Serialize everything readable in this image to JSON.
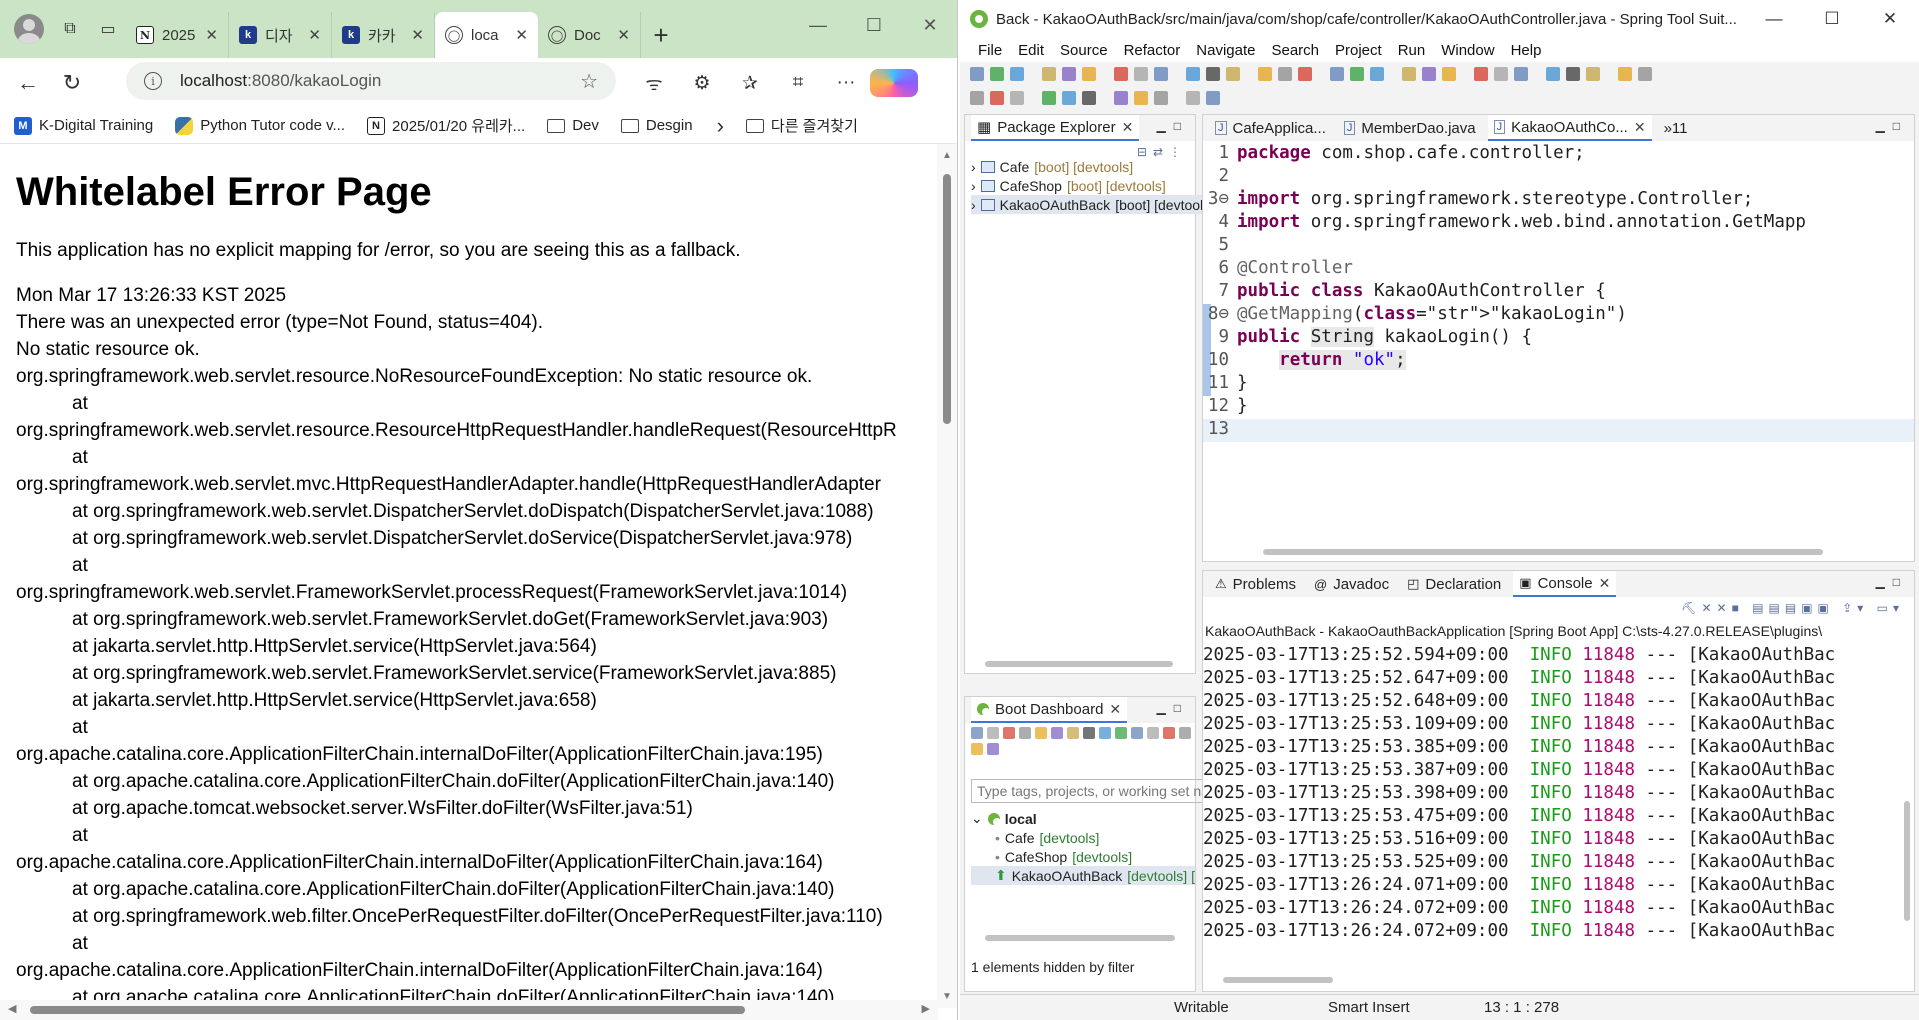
{
  "browser": {
    "tabs": [
      {
        "label": "2025",
        "icon": "notion-icon"
      },
      {
        "label": "디자",
        "icon": "k-icon"
      },
      {
        "label": "카카",
        "icon": "k-icon"
      },
      {
        "label": "loca",
        "icon": "globe-icon",
        "active": true
      },
      {
        "label": "Doc",
        "icon": "globe-icon"
      }
    ],
    "url_host": "localhost",
    "url_path": ":8080/kakaoLogin",
    "bookmarks": [
      {
        "label": "K-Digital Training",
        "icon": "m"
      },
      {
        "label": "Python Tutor code v...",
        "icon": "py"
      },
      {
        "label": "2025/01/20 유레카...",
        "icon": "n"
      },
      {
        "label": "Dev",
        "icon": "folder"
      },
      {
        "label": "Desgin",
        "icon": "folder"
      }
    ],
    "other_bookmarks": "다른 즐겨찾기"
  },
  "error_page": {
    "title": "Whitelabel Error Page",
    "message": "This application has no explicit mapping for /error, so you are seeing this as a fallback.",
    "timestamp": "Mon Mar 17 13:26:33 KST 2025",
    "error_line": "There was an unexpected error (type=Not Found, status=404).",
    "detail": "No static resource ok.",
    "trace": [
      {
        "text": "org.springframework.web.servlet.resource.NoResourceFoundException: No static resource ok.",
        "indent": false
      },
      {
        "text": "at",
        "indent": true
      },
      {
        "text": "org.springframework.web.servlet.resource.ResourceHttpRequestHandler.handleRequest(ResourceHttpR",
        "indent": false
      },
      {
        "text": "at",
        "indent": true
      },
      {
        "text": "org.springframework.web.servlet.mvc.HttpRequestHandlerAdapter.handle(HttpRequestHandlerAdapter",
        "indent": false
      },
      {
        "text": "at org.springframework.web.servlet.DispatcherServlet.doDispatch(DispatcherServlet.java:1088)",
        "indent": true
      },
      {
        "text": "at org.springframework.web.servlet.DispatcherServlet.doService(DispatcherServlet.java:978)",
        "indent": true
      },
      {
        "text": "at",
        "indent": true
      },
      {
        "text": "org.springframework.web.servlet.FrameworkServlet.processRequest(FrameworkServlet.java:1014)",
        "indent": false
      },
      {
        "text": "at org.springframework.web.servlet.FrameworkServlet.doGet(FrameworkServlet.java:903)",
        "indent": true
      },
      {
        "text": "at jakarta.servlet.http.HttpServlet.service(HttpServlet.java:564)",
        "indent": true
      },
      {
        "text": "at org.springframework.web.servlet.FrameworkServlet.service(FrameworkServlet.java:885)",
        "indent": true
      },
      {
        "text": "at jakarta.servlet.http.HttpServlet.service(HttpServlet.java:658)",
        "indent": true
      },
      {
        "text": "at",
        "indent": true
      },
      {
        "text": "org.apache.catalina.core.ApplicationFilterChain.internalDoFilter(ApplicationFilterChain.java:195)",
        "indent": false
      },
      {
        "text": "at org.apache.catalina.core.ApplicationFilterChain.doFilter(ApplicationFilterChain.java:140)",
        "indent": true
      },
      {
        "text": "at org.apache.tomcat.websocket.server.WsFilter.doFilter(WsFilter.java:51)",
        "indent": true
      },
      {
        "text": "at",
        "indent": true
      },
      {
        "text": "org.apache.catalina.core.ApplicationFilterChain.internalDoFilter(ApplicationFilterChain.java:164)",
        "indent": false
      },
      {
        "text": "at org.apache.catalina.core.ApplicationFilterChain.doFilter(ApplicationFilterChain.java:140)",
        "indent": true
      },
      {
        "text": "at org.springframework.web.filter.OncePerRequestFilter.doFilter(OncePerRequestFilter.java:110)",
        "indent": true
      },
      {
        "text": "at",
        "indent": true
      },
      {
        "text": "org.apache.catalina.core.ApplicationFilterChain.internalDoFilter(ApplicationFilterChain.java:164)",
        "indent": false
      },
      {
        "text": "at org.apache.catalina.core.ApplicationFilterChain.doFilter(ApplicationFilterChain.java:140)",
        "indent": true
      }
    ]
  },
  "sts": {
    "title": "Back - KakaoOAuthBack/src/main/java/com/shop/cafe/controller/KakaoOAuthController.java - Spring Tool Suit...",
    "menu": [
      "File",
      "Edit",
      "Source",
      "Refactor",
      "Navigate",
      "Search",
      "Project",
      "Run",
      "Window",
      "Help"
    ],
    "package_explorer": {
      "tab": "Package Explorer",
      "projects": [
        {
          "name": "Cafe",
          "tags": "[boot] [devtools]"
        },
        {
          "name": "CafeShop",
          "tags": "[boot] [devtools]"
        },
        {
          "name": "KakaoOAuthBack",
          "tags": "[boot] [devtools",
          "selected": true
        }
      ]
    },
    "editor_tabs": [
      "CafeApplica...",
      "MemberDao.java",
      "KakaoOAuthCo...",
      "»11"
    ],
    "code": [
      {
        "n": "1",
        "html": "package com.shop.cafe.controller;"
      },
      {
        "n": "2",
        "html": ""
      },
      {
        "n": "3⊖",
        "html": "import org.springframework.stereotype.Controller;"
      },
      {
        "n": "4",
        "html": "import org.springframework.web.bind.annotation.GetMapp"
      },
      {
        "n": "5",
        "html": ""
      },
      {
        "n": "6",
        "html": "@Controller"
      },
      {
        "n": "7",
        "html": "public class KakaoOAuthController {"
      },
      {
        "n": "8⊖",
        "html": "@GetMapping(\"kakaoLogin\")"
      },
      {
        "n": "9",
        "html": "public String kakaoLogin() {"
      },
      {
        "n": "10",
        "html": "    return \"ok\";"
      },
      {
        "n": "11",
        "html": "}"
      },
      {
        "n": "12",
        "html": "}"
      },
      {
        "n": "13",
        "html": ""
      }
    ],
    "bottom_tabs": [
      "Problems",
      "Javadoc",
      "Declaration",
      "Console"
    ],
    "console_title": "KakaoOAuthBack - KakaoOauthBackApplication [Spring Boot App] C:\\sts-4.27.0.RELEASE\\plugins\\",
    "console_lines": [
      "2025-03-17T13:25:52.594+09:00",
      "2025-03-17T13:25:52.647+09:00",
      "2025-03-17T13:25:52.648+09:00",
      "2025-03-17T13:25:53.109+09:00",
      "2025-03-17T13:25:53.385+09:00",
      "2025-03-17T13:25:53.387+09:00",
      "2025-03-17T13:25:53.398+09:00",
      "2025-03-17T13:25:53.475+09:00",
      "2025-03-17T13:25:53.516+09:00",
      "2025-03-17T13:25:53.525+09:00",
      "2025-03-17T13:26:24.071+09:00",
      "2025-03-17T13:26:24.072+09:00",
      "2025-03-17T13:26:24.072+09:00"
    ],
    "console_level": "INFO",
    "console_pid": "11848",
    "console_sep": "---",
    "console_tail": "[KakaoOAuthBac",
    "boot_dashboard": {
      "tab": "Boot Dashboard",
      "filter_placeholder": "Type tags, projects, or working set nar",
      "group": "local",
      "apps": [
        {
          "name": "Cafe",
          "tags": "[devtools]"
        },
        {
          "name": "CafeShop",
          "tags": "[devtools]"
        },
        {
          "name": "KakaoOAuthBack",
          "tags": "[devtools] [",
          "running": true
        }
      ],
      "hidden": "1 elements hidden by filter"
    },
    "status": {
      "mode": "Writable",
      "insert": "Smart Insert",
      "position": "13 : 1 : 278"
    }
  }
}
